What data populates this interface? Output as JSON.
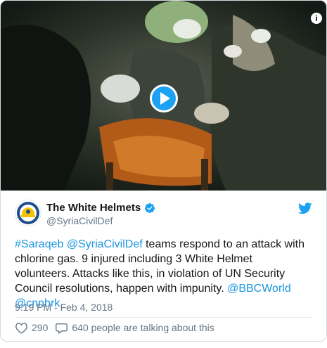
{
  "colors": {
    "link": "#1b95e0",
    "twitter_blue": "#1da1f2",
    "text": "#14171a",
    "muted": "#657786"
  },
  "media": {
    "type": "video",
    "play_icon": "play-icon",
    "info_glyph": "i"
  },
  "account": {
    "name": "The White Helmets",
    "handle": "@SyriaCivilDef",
    "verified": true,
    "avatar_icon": "white-helmets-logo"
  },
  "tweet": {
    "hashtag": "#Saraqeb",
    "mention_1": "@SyriaCivilDef",
    "body_1": " teams respond to an attack with chlorine gas. 9 injured including 3 White Helmet volunteers. Attacks like this, in violation of UN Security Council resolutions, happen with impunity. ",
    "mention_2": "@BBCWorld",
    "mention_3": "@cnnbrk",
    "timestamp": "9:19 PM - Feb 4, 2018"
  },
  "actions": {
    "likes": "290",
    "replies_text": "640 people are talking about this"
  }
}
